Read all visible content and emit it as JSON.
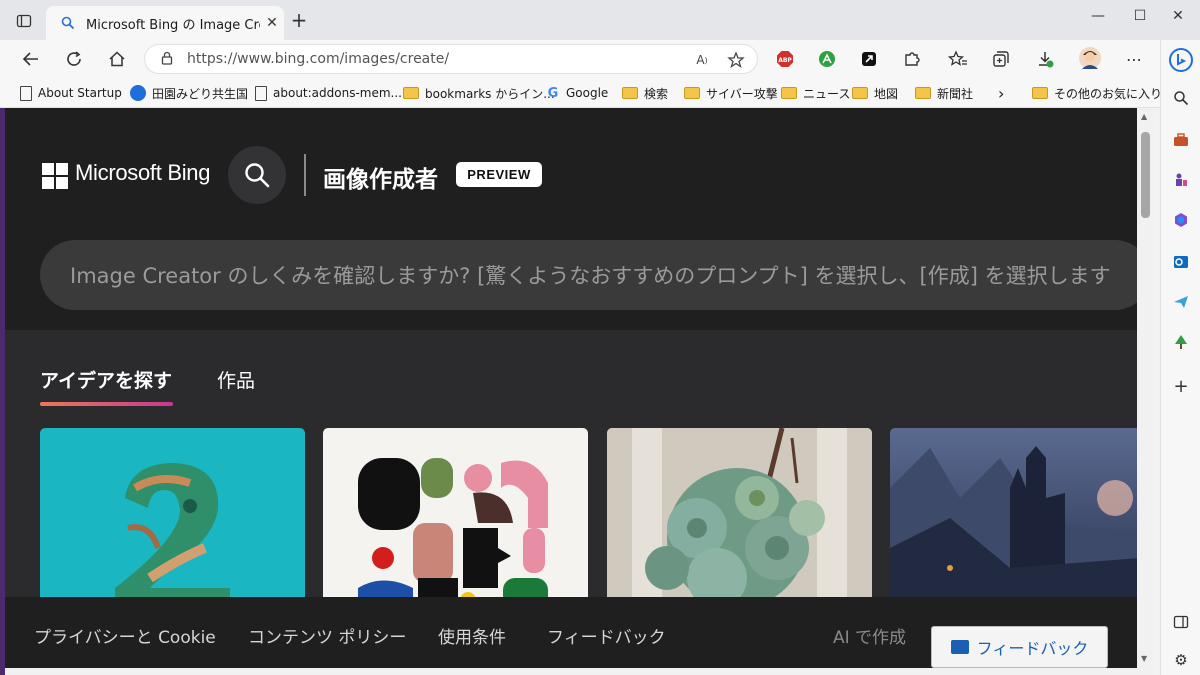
{
  "browser": {
    "tab_title": "Microsoft Bing の Image Creator",
    "url": "https://www.bing.com/images/create/",
    "window_controls": {
      "minimize": "—",
      "maximize": "☐",
      "close": "✕"
    }
  },
  "bookmarks": [
    {
      "label": "About Startup",
      "icon": "doc-icon"
    },
    {
      "label": "田園みどり共生国",
      "icon": "globe-icon"
    },
    {
      "label": "about:addons-mem...",
      "icon": "doc-icon"
    },
    {
      "label": "bookmarks からイン...",
      "icon": "folder-icon"
    },
    {
      "label": "Google",
      "icon": "google-icon"
    },
    {
      "label": "検索",
      "icon": "folder-icon"
    },
    {
      "label": "サイバー攻撃",
      "icon": "folder-icon"
    },
    {
      "label": "ニュース",
      "icon": "folder-icon"
    },
    {
      "label": "地図",
      "icon": "folder-icon"
    },
    {
      "label": "新聞社",
      "icon": "folder-icon"
    },
    {
      "label": "その他のお気に入り",
      "icon": "folder-icon"
    }
  ],
  "extensions": {
    "abp": "ABP"
  },
  "page": {
    "brand": "Microsoft Bing",
    "title": "画像作成者",
    "badge": "PREVIEW",
    "prompt_placeholder": "Image Creator のしくみを確認しますか? [驚くようなおすすめのプロンプト] を選択し、[作成] を選択します",
    "tabs": [
      {
        "label": "アイデアを探す",
        "active": true
      },
      {
        "label": "作品",
        "active": false
      }
    ],
    "cards": [
      {
        "name": "number-two-chameleon"
      },
      {
        "name": "abstract-shapes"
      },
      {
        "name": "succulent-bouquet"
      },
      {
        "name": "dark-castle-landscape"
      }
    ],
    "footer": {
      "privacy": "プライバシーと Cookie",
      "content_policy": "コンテンツ ポリシー",
      "terms": "使用条件",
      "feedback_link": "フィードバック",
      "ai_created": "AI で作成",
      "feedback_button": "フィードバック"
    }
  },
  "colors": {
    "accent_gradient_start": "#e8795b",
    "accent_gradient_end": "#c8388f",
    "page_bg": "#2b2a2c",
    "hero_bg": "#1f1f20"
  }
}
